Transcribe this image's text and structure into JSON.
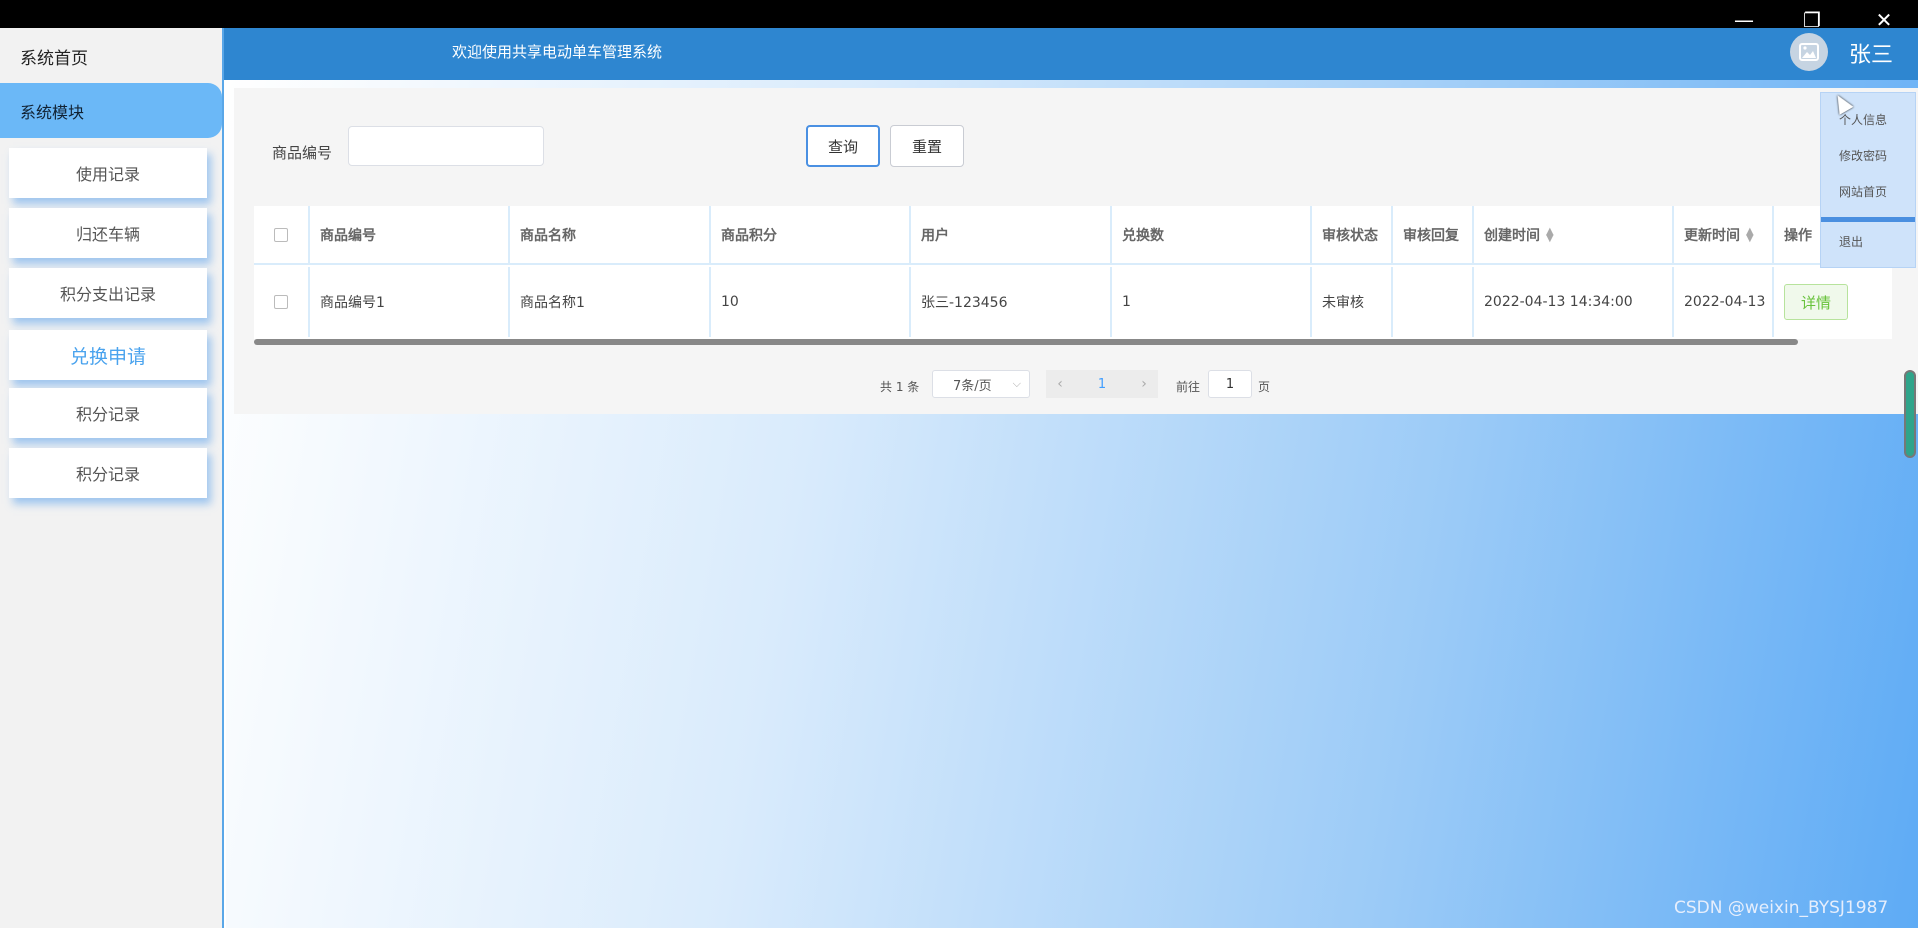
{
  "window": {
    "minimize": "—",
    "maximize": "❐",
    "close": "✕"
  },
  "sidebar": {
    "home": "系统首页",
    "module": "系统模块",
    "items": [
      {
        "label": "使用记录"
      },
      {
        "label": "归还车辆"
      },
      {
        "label": "积分支出记录"
      },
      {
        "label": "兑换申请",
        "active": true
      },
      {
        "label": "积分记录"
      },
      {
        "label": "积分记录"
      }
    ]
  },
  "header": {
    "title": "欢迎使用共享电动单车管理系统",
    "username": "张三",
    "avatar_icon": "image-icon"
  },
  "dropdown": {
    "items": [
      "个人信息",
      "修改密码",
      "网站首页",
      "退出"
    ]
  },
  "filter": {
    "label": "商品编号",
    "value": "",
    "query_label": "查询",
    "reset_label": "重置"
  },
  "table": {
    "headers": [
      "商品编号",
      "商品名称",
      "商品积分",
      "用户",
      "兑换数",
      "审核状态",
      "审核回复",
      "创建时间",
      "更新时间",
      "操作"
    ],
    "rows": [
      {
        "code": "商品编号1",
        "name": "商品名称1",
        "points": "10",
        "user": "张三-123456",
        "count": "1",
        "status": "未审核",
        "reply": "",
        "created": "2022-04-13 14:34:00",
        "updated": "2022-04-13",
        "action": "详情"
      }
    ]
  },
  "pagination": {
    "total": "共 1 条",
    "page_size": "7条/页",
    "current": "1",
    "goto_label": "前往",
    "goto_value": "1",
    "page_suffix": "页"
  },
  "watermark": "CSDN @weixin_BYSJ1987",
  "colors": {
    "header": "#2e86d0",
    "sidebar_active": "#6bb8f7",
    "detail_button": "#67c23a",
    "pagination_current": "#409eff"
  }
}
